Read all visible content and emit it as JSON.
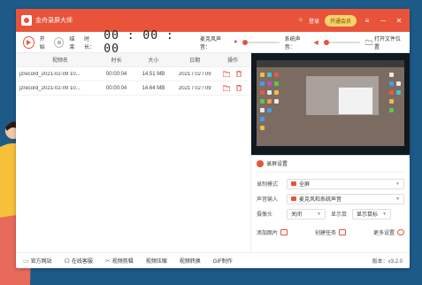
{
  "titlebar": {
    "app_name": "金舟录屏大师",
    "login": "登录",
    "vip": "开通会员",
    "menu": "≡",
    "minimize": "─",
    "close": "✕"
  },
  "toolbar": {
    "start": "开始",
    "stop": "结束",
    "duration_label": "时长：",
    "duration": "00 : 00 : 00",
    "mic_label": "麦克风声音：",
    "system_label": "系统声音：",
    "open_folder": "打开文件位置"
  },
  "table": {
    "headers": [
      "视频名",
      "时长",
      "大小",
      "日期",
      "操作"
    ],
    "rows": [
      {
        "name": "jzrecord_2021-02-09 10...",
        "duration": "00:00:04",
        "size": "14.51 MB",
        "date": "2021 / 02 / 09"
      },
      {
        "name": "jzrecord_2021-02-09 10...",
        "duration": "00:00:04",
        "size": "14.64 MB",
        "date": "2021 / 02 / 09"
      }
    ]
  },
  "settings": {
    "title": "录屏设置",
    "mode_label": "录制模式",
    "mode_value": "全屏",
    "audio_label": "声音输入",
    "audio_value": "麦克风和系统声音",
    "camera_label": "摄像头",
    "camera_value": "关闭",
    "cursor_label": "显示鼠",
    "cursor_value": "显示鼠标",
    "add_image": "添加图片",
    "create_task": "创建任务",
    "more": "更多设置"
  },
  "statusbar": {
    "website": "官方网站",
    "service": "在线客服",
    "cut": "视频剪辑",
    "compress": "视频压缩",
    "convert": "视频转换",
    "gif": "GIF制作",
    "version": "版本：v3.2.0"
  },
  "colors": {
    "accent": "#e8533a",
    "background": "#1d5a88",
    "vip": "#f6d36b"
  }
}
